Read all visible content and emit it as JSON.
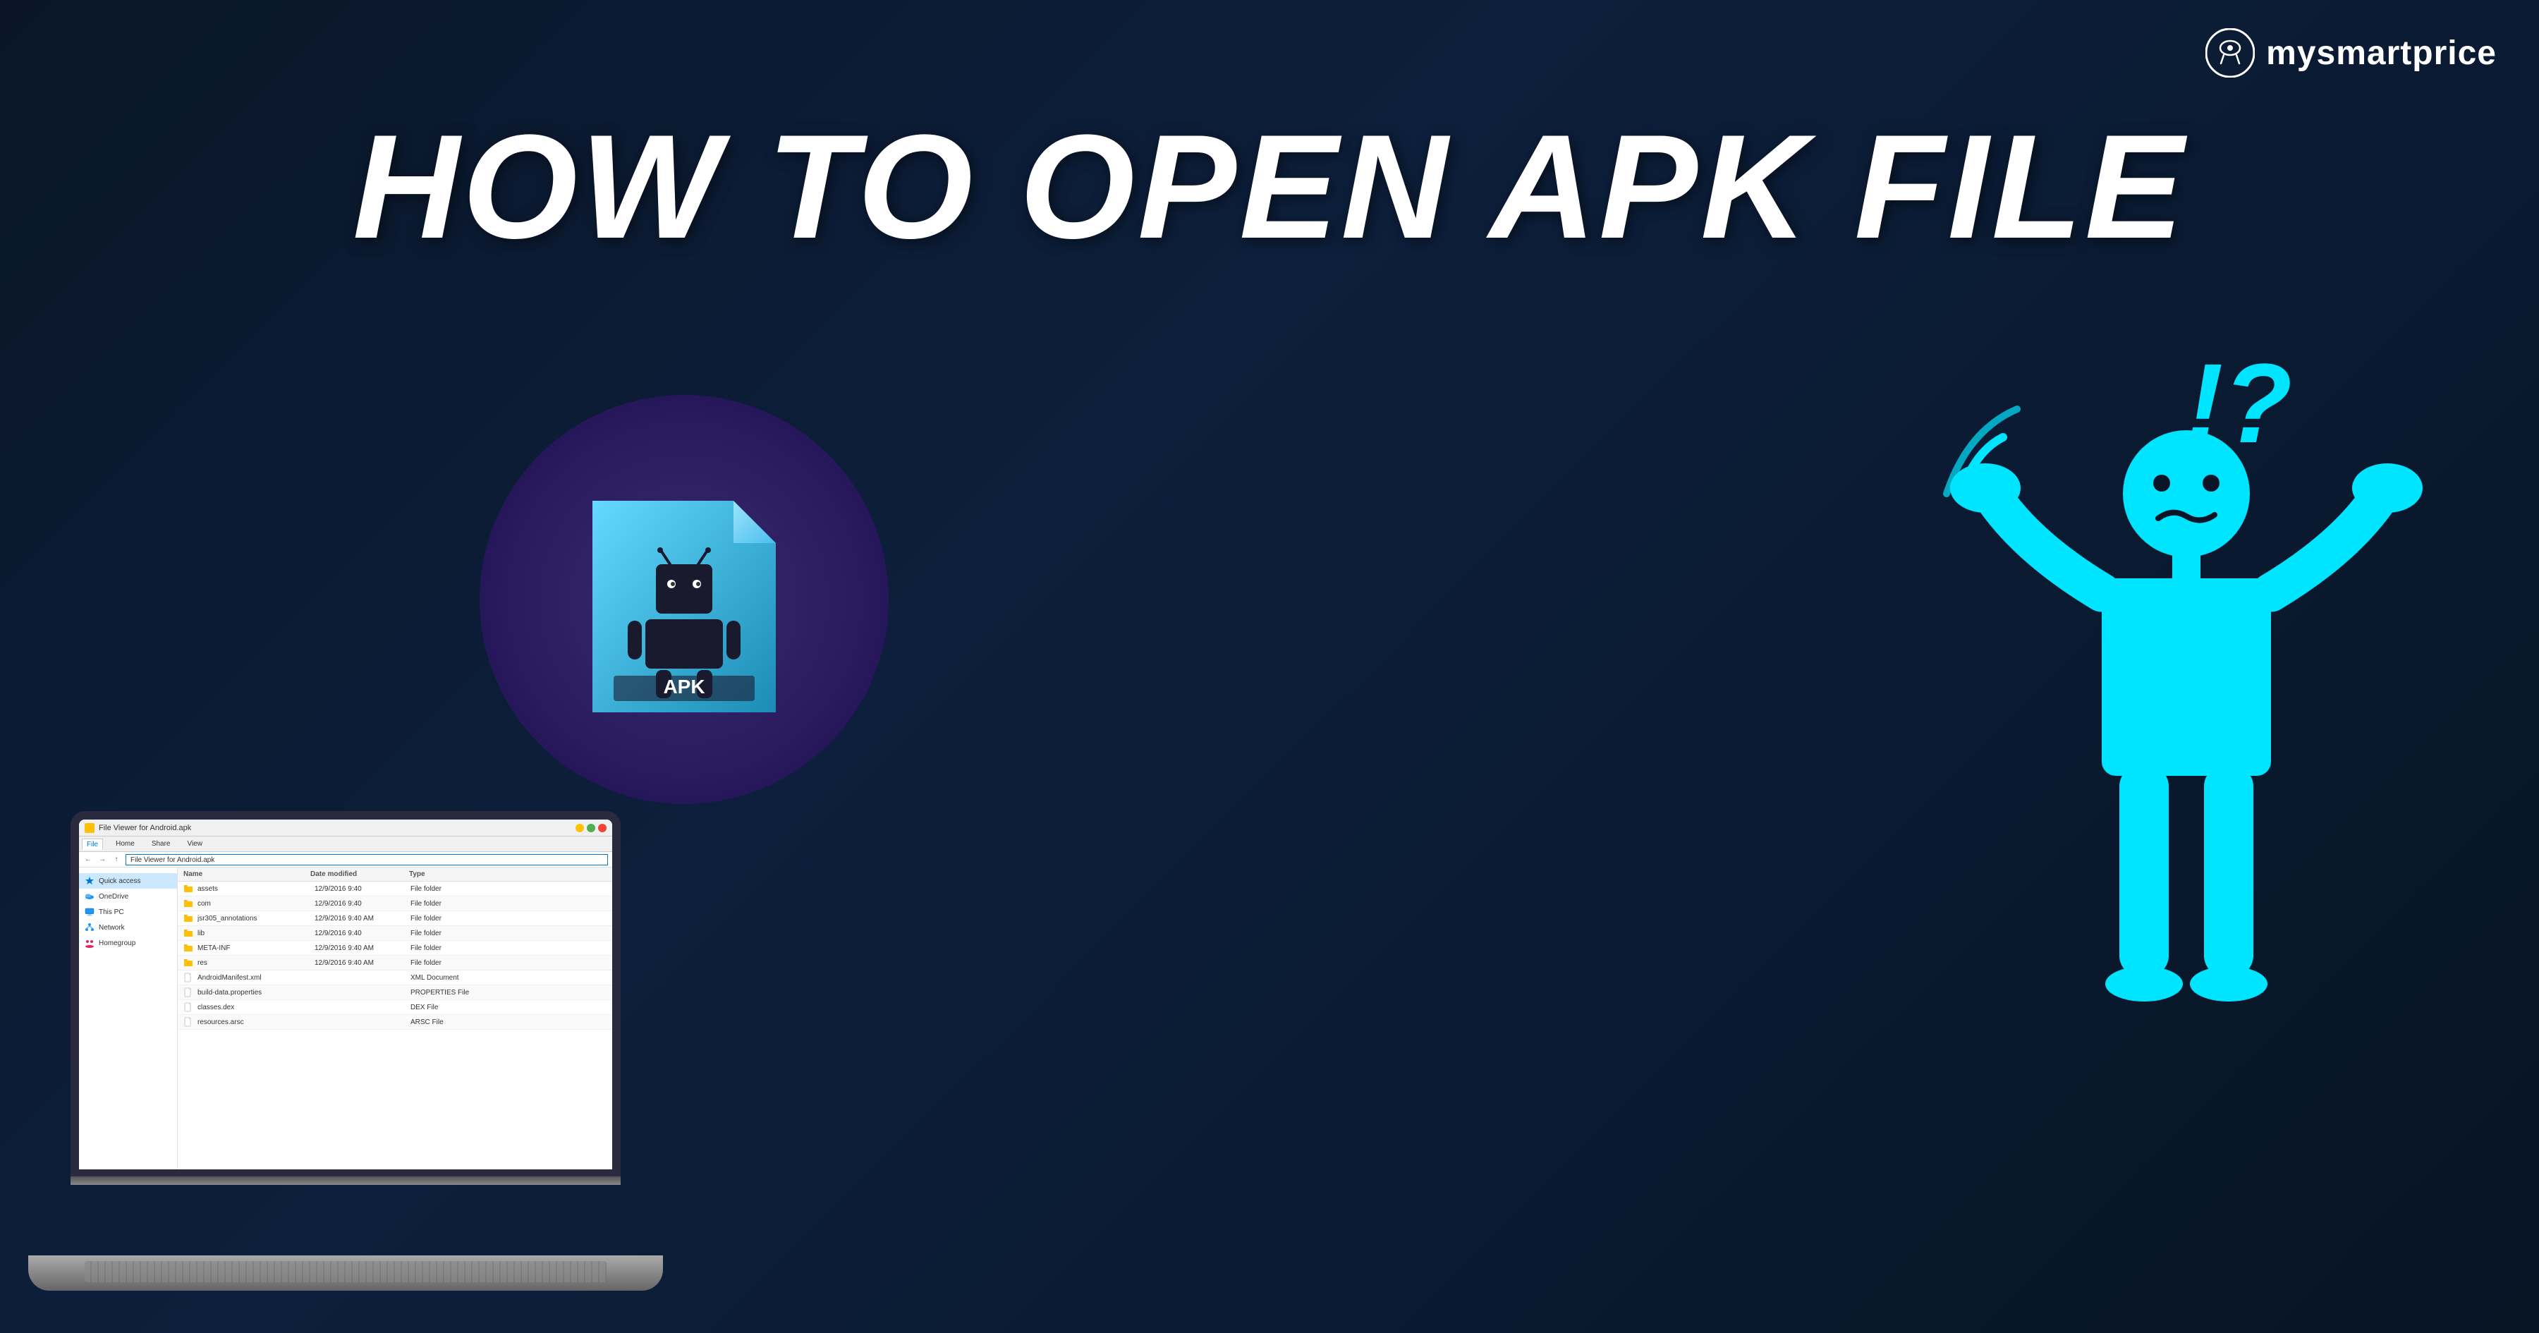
{
  "logo": {
    "text": "mysmartprice",
    "icon_alt": "mysmartprice-logo"
  },
  "headline": {
    "line1": "HOW TO OPEN APK FILE"
  },
  "explorer": {
    "titlebar": {
      "title": "File Viewer for Android.apk"
    },
    "ribbon_tabs": [
      "File",
      "Home",
      "Share",
      "View"
    ],
    "active_tab": "File",
    "address_path": "File Viewer for Android.apk",
    "sidebar_items": [
      {
        "label": "Quick access",
        "type": "quick-access"
      },
      {
        "label": "OneDrive",
        "type": "onedrive"
      },
      {
        "label": "This PC",
        "type": "pc"
      },
      {
        "label": "Network",
        "type": "network"
      },
      {
        "label": "Homegroup",
        "type": "homegroup"
      }
    ],
    "file_list_headers": [
      "Name",
      "Date modified",
      "Type"
    ],
    "files": [
      {
        "name": "assets",
        "date": "12/9/2016 9:40",
        "type": "File folder",
        "is_folder": true
      },
      {
        "name": "com",
        "date": "12/9/2016 9:40",
        "type": "File folder",
        "is_folder": true
      },
      {
        "name": "jsr305_annotations",
        "date": "12/9/2016 9:40 AM",
        "type": "File folder",
        "is_folder": true
      },
      {
        "name": "lib",
        "date": "12/9/2016 9:40",
        "type": "File folder",
        "is_folder": true
      },
      {
        "name": "META-INF",
        "date": "12/9/2016 9:40 AM",
        "type": "File folder",
        "is_folder": true
      },
      {
        "name": "res",
        "date": "12/9/2016 9:40 AM",
        "type": "File folder",
        "is_folder": true
      },
      {
        "name": "AndroidManifest.xml",
        "date": "",
        "type": "XML Document",
        "is_folder": false
      },
      {
        "name": "build-data.properties",
        "date": "",
        "type": "PROPERTIES File",
        "is_folder": false
      },
      {
        "name": "classes.dex",
        "date": "",
        "type": "DEX File",
        "is_folder": false
      },
      {
        "name": "resources.arsc",
        "date": "",
        "type": "ARSC File",
        "is_folder": false
      }
    ]
  },
  "apk_label": "APK",
  "exclamation": "!?",
  "colors": {
    "background_dark": "#0a1628",
    "accent_cyan": "#00e5ff",
    "folder_yellow": "#ffc107",
    "explorer_blue": "#0078d7"
  }
}
